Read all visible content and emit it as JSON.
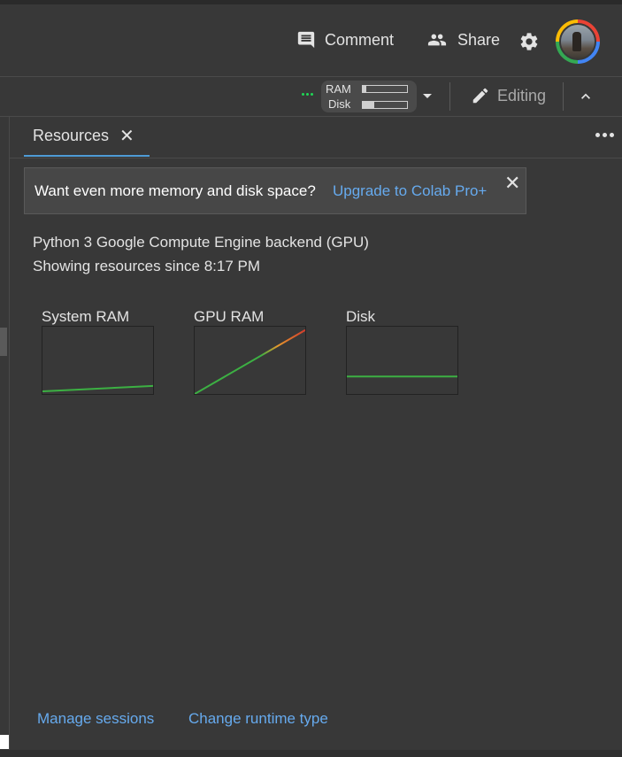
{
  "header": {
    "comment_label": "Comment",
    "share_label": "Share",
    "settings_icon": "gear-icon",
    "avatar_icon": "user-avatar"
  },
  "toolbar": {
    "ram_label": "RAM",
    "disk_label": "Disk",
    "ram_usage": 0.08,
    "disk_usage": 0.25,
    "status_color": "#1fd655",
    "editing_label": "Editing"
  },
  "panel": {
    "tab_label": "Resources",
    "banner": {
      "text": "Want even more memory and disk space?",
      "link": "Upgrade to Colab Pro+"
    },
    "backend": "Python 3 Google Compute Engine backend (GPU)",
    "since": "Showing resources since 8:17 PM",
    "graphs": [
      {
        "title": "System RAM",
        "start": 0.04,
        "end": 0.12
      },
      {
        "title": "GPU RAM",
        "start": 0.0,
        "end": 0.95
      },
      {
        "title": "Disk",
        "start": 0.26,
        "end": 0.26
      }
    ],
    "manage_sessions": "Manage sessions",
    "change_runtime": "Change runtime type"
  },
  "colors": {
    "accent_link": "#66aaee",
    "tab_underline": "#4e9bd6",
    "graph_green": "#3cb043",
    "graph_orange": "#e69a2d",
    "graph_red": "#d33a2c"
  }
}
